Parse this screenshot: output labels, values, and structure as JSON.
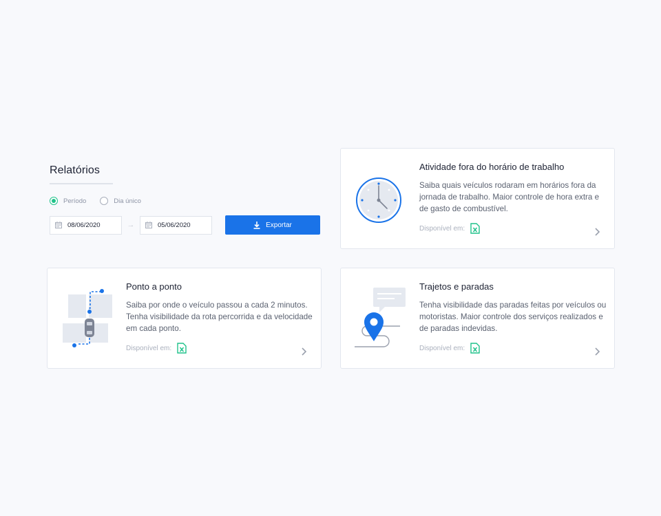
{
  "reports": {
    "title": "Relatórios",
    "radio_period": "Período",
    "radio_single": "Dia único",
    "date_start": "08/06/2020",
    "date_end": "05/06/2020",
    "export_label": "Exportar"
  },
  "cards": [
    {
      "title": "Atividade fora do horário de trabalho",
      "description": "Saiba quais veículos rodaram em horários fora da jornada de trabalho. Maior controle de hora extra e de gasto de combustível.",
      "available": "Disponível em:"
    },
    {
      "title": "Ponto a ponto",
      "description": "Saiba por onde o veículo passou a cada 2 minutos. Tenha visibilidade da rota percorrida e da velocidade em cada ponto.",
      "available": "Disponível em:"
    },
    {
      "title": "Trajetos e paradas",
      "description": "Tenha visibilidade das paradas feitas por veículos ou motoristas. Maior controle dos serviços realizados e de paradas indevidas.",
      "available": "Disponível em:"
    }
  ],
  "colors": {
    "primary": "#1a73e8",
    "success": "#1fc28a",
    "background": "#f8f9fc"
  }
}
